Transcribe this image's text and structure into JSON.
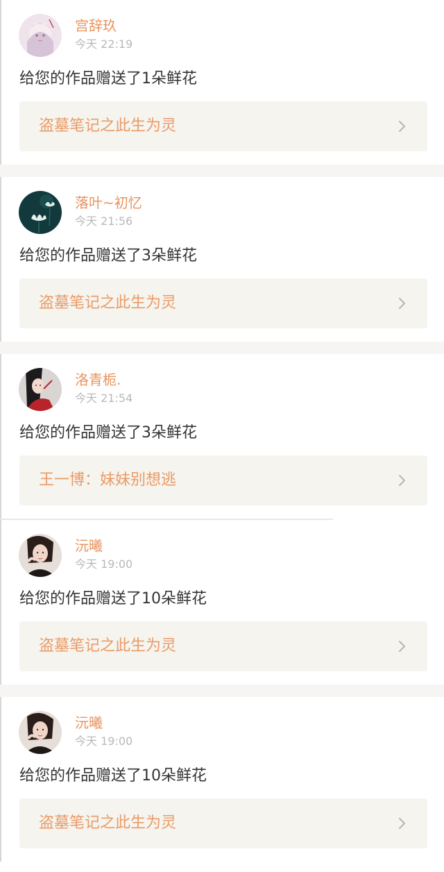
{
  "notifications": [
    {
      "username": "宫辞玖",
      "time": "今天 22:19",
      "message": "给您的作品赠送了1朵鲜花",
      "work_title": "盗墓笔记之此生为灵",
      "avatar": "anime-girl-avatar"
    },
    {
      "username": "落叶~初忆",
      "time": "今天 21:56",
      "message": "给您的作品赠送了3朵鲜花",
      "work_title": "盗墓笔记之此生为灵",
      "avatar": "lotus-avatar"
    },
    {
      "username": "洛青栀.",
      "time": "今天 21:54",
      "message": "给您的作品赠送了3朵鲜花",
      "work_title": "王一博：妹妹别想逃",
      "avatar": "girl-red-dress-avatar"
    },
    {
      "username": "沅曦",
      "time": "今天 19:00",
      "message": "给您的作品赠送了10朵鲜花",
      "work_title": "盗墓笔记之此生为灵",
      "avatar": "girl-portrait-avatar"
    },
    {
      "username": "沅曦",
      "time": "今天 19:00",
      "message": "给您的作品赠送了10朵鲜花",
      "work_title": "盗墓笔记之此生为灵",
      "avatar": "girl-portrait-avatar"
    }
  ],
  "colors": {
    "username": "#e8935f",
    "work_title": "#ea9a67",
    "work_bg": "#f5f4ee",
    "separator": "#f6f5f3",
    "time": "#b8b8b8",
    "message": "#333333"
  }
}
